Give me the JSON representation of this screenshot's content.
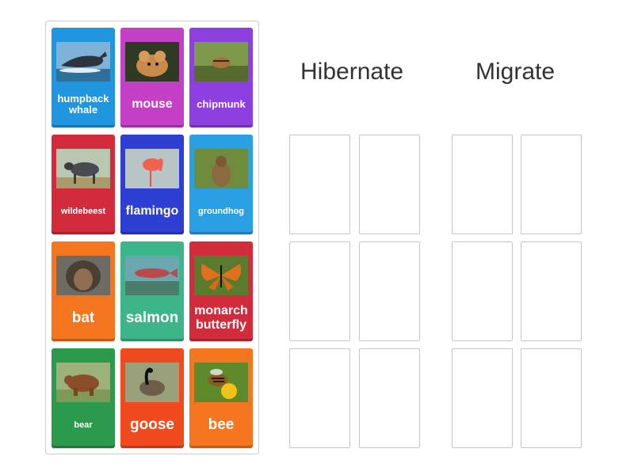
{
  "tray": {
    "cards": [
      {
        "label": "humpback whale",
        "color": "#2196e0",
        "icon": "whale-icon"
      },
      {
        "label": "mouse",
        "color": "#c440c6",
        "icon": "mouse-icon"
      },
      {
        "label": "chipmunk",
        "color": "#8e3fe0",
        "icon": "chipmunk-icon"
      },
      {
        "label": "wildebeest",
        "color": "#d22b3c",
        "icon": "wildebeest-icon"
      },
      {
        "label": "flamingo",
        "color": "#2e3fd4",
        "icon": "flamingo-icon"
      },
      {
        "label": "groundhog",
        "color": "#2aa0e4",
        "icon": "groundhog-icon"
      },
      {
        "label": "bat",
        "color": "#f5761e",
        "icon": "bat-icon"
      },
      {
        "label": "salmon",
        "color": "#3db58a",
        "icon": "salmon-icon"
      },
      {
        "label": "monarch butterfly",
        "color": "#d22b3c",
        "icon": "butterfly-icon"
      },
      {
        "label": "bear",
        "color": "#2b9a4c",
        "icon": "bear-icon"
      },
      {
        "label": "goose",
        "color": "#f04a1e",
        "icon": "goose-icon"
      },
      {
        "label": "bee",
        "color": "#f5761e",
        "icon": "bee-icon"
      }
    ]
  },
  "groups": [
    {
      "title": "Hibernate"
    },
    {
      "title": "Migrate"
    }
  ]
}
